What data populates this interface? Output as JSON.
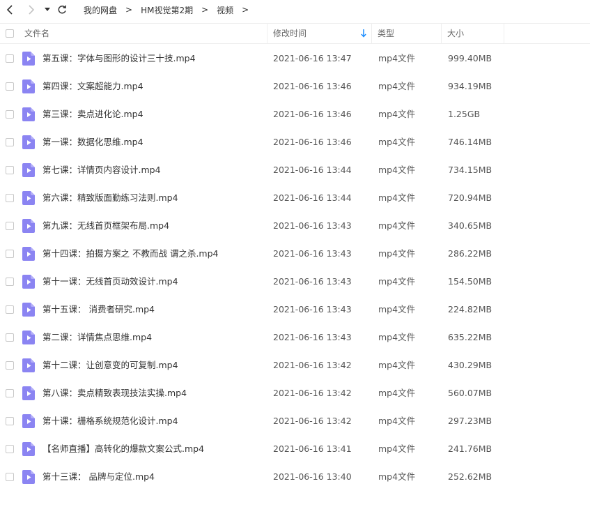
{
  "breadcrumb": [
    "我的网盘",
    "HM视觉第2期",
    "视频"
  ],
  "columns": {
    "name": "文件名",
    "modified": "修改时间",
    "type": "类型",
    "size": "大小"
  },
  "colors": {
    "accent": "#1a8cff",
    "file_icon": "#8b84f2"
  },
  "files": [
    {
      "name": "第五课：字体与图形的设计三十技.mp4",
      "modified": "2021-06-16 13:47",
      "type": "mp4文件",
      "size": "999.40MB"
    },
    {
      "name": "第四课：文案超能力.mp4",
      "modified": "2021-06-16 13:46",
      "type": "mp4文件",
      "size": "934.19MB"
    },
    {
      "name": "第三课：卖点进化论.mp4",
      "modified": "2021-06-16 13:46",
      "type": "mp4文件",
      "size": "1.25GB"
    },
    {
      "name": "第一课：数据化思维.mp4",
      "modified": "2021-06-16 13:46",
      "type": "mp4文件",
      "size": "746.14MB"
    },
    {
      "name": "第七课：详情页内容设计.mp4",
      "modified": "2021-06-16 13:44",
      "type": "mp4文件",
      "size": "734.15MB"
    },
    {
      "name": "第六课：精致版面勤练习法则.mp4",
      "modified": "2021-06-16 13:44",
      "type": "mp4文件",
      "size": "720.94MB"
    },
    {
      "name": "第九课：无线首页框架布局.mp4",
      "modified": "2021-06-16 13:43",
      "type": "mp4文件",
      "size": "340.65MB"
    },
    {
      "name": "第十四课：拍摄方案之 不教而战 谓之杀.mp4",
      "modified": "2021-06-16 13:43",
      "type": "mp4文件",
      "size": "286.22MB"
    },
    {
      "name": "第十一课：无线首页动效设计.mp4",
      "modified": "2021-06-16 13:43",
      "type": "mp4文件",
      "size": "154.50MB"
    },
    {
      "name": "第十五课： 消费者研究.mp4",
      "modified": "2021-06-16 13:43",
      "type": "mp4文件",
      "size": "224.82MB"
    },
    {
      "name": "第二课：详情焦点思维.mp4",
      "modified": "2021-06-16 13:43",
      "type": "mp4文件",
      "size": "635.22MB"
    },
    {
      "name": "第十二课：让创意变的可复制.mp4",
      "modified": "2021-06-16 13:42",
      "type": "mp4文件",
      "size": "430.29MB"
    },
    {
      "name": "第八课：卖点精致表现技法实操.mp4",
      "modified": "2021-06-16 13:42",
      "type": "mp4文件",
      "size": "560.07MB"
    },
    {
      "name": "第十课：栅格系统规范化设计.mp4",
      "modified": "2021-06-16 13:42",
      "type": "mp4文件",
      "size": "297.23MB"
    },
    {
      "name": "【名师直播】高转化的爆款文案公式.mp4",
      "modified": "2021-06-16 13:41",
      "type": "mp4文件",
      "size": "241.76MB"
    },
    {
      "name": "第十三课： 品牌与定位.mp4",
      "modified": "2021-06-16 13:40",
      "type": "mp4文件",
      "size": "252.62MB"
    }
  ]
}
